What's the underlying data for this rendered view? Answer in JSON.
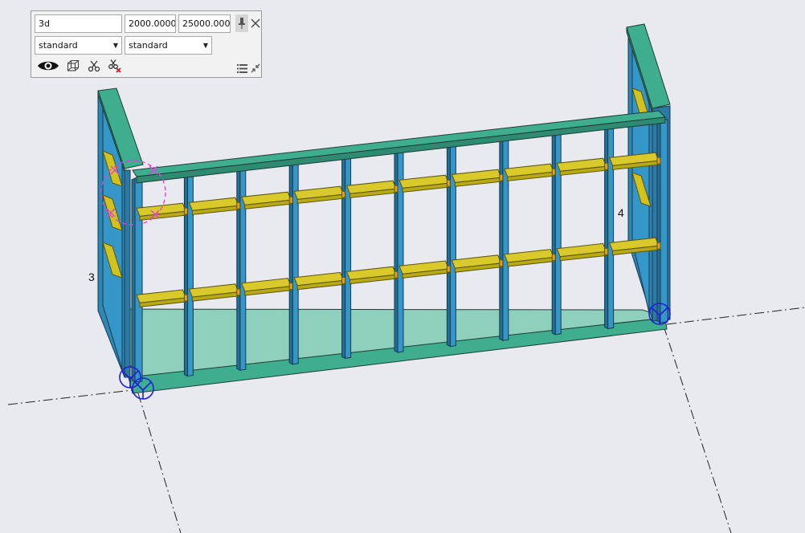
{
  "view_panel": {
    "view_name": "3d",
    "depth_1": "2000.000000",
    "depth_2": "25000.000000",
    "display_setting_1": "standard",
    "display_setting_2": "standard"
  },
  "model": {
    "labels": {
      "left": "3",
      "right": "4"
    }
  },
  "icons": [
    "eye-icon",
    "wireframe-cube-icon",
    "scissors-icon",
    "clip-remove-icon",
    "pin-icon",
    "close-icon",
    "list-icon",
    "collapse-icon"
  ],
  "colors": {
    "background": "#e9e9f0",
    "top_plate": "#3fae8f",
    "studs": "#3597c8",
    "shelves": "#d2c21f",
    "axis_symbol": "#1f1fd6",
    "selection": "#e040e0"
  }
}
